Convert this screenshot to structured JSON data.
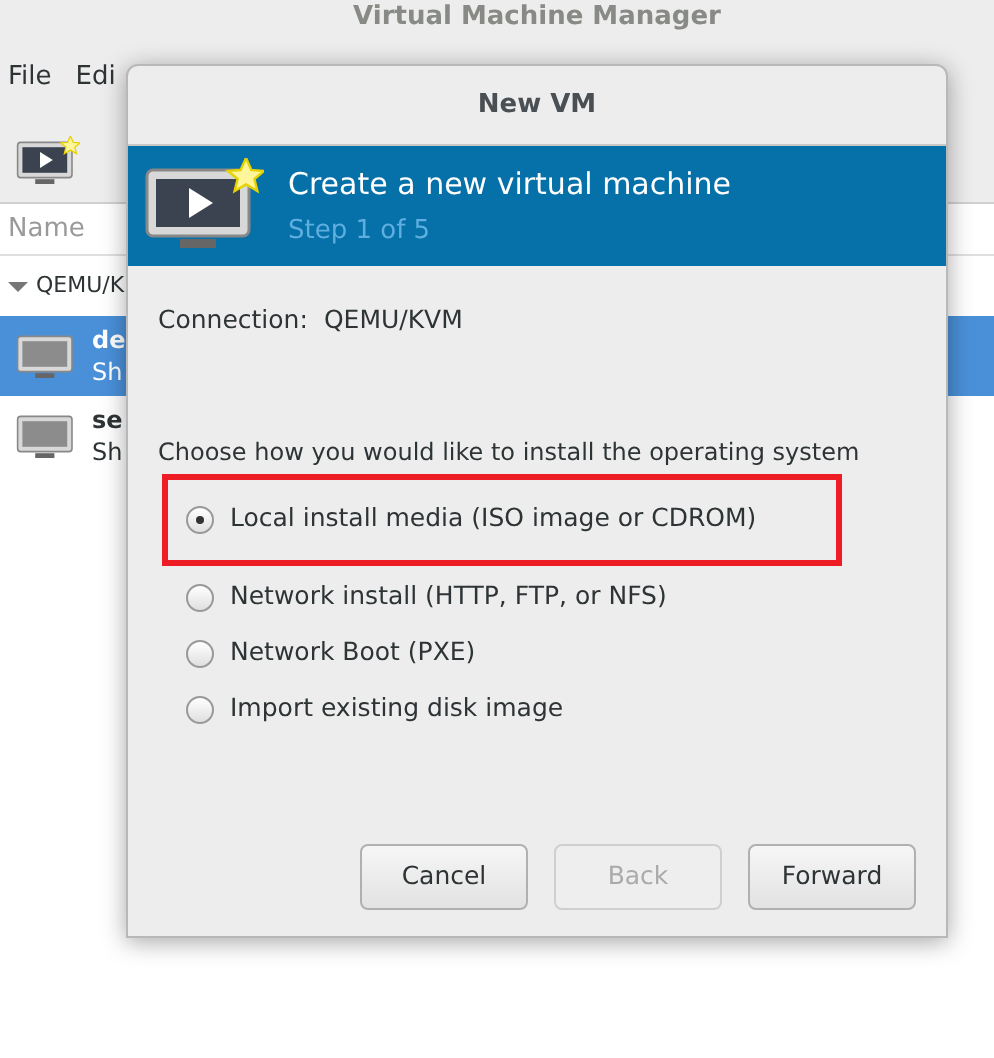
{
  "background_window": {
    "title": "Virtual Machine Manager",
    "menu": [
      "File",
      "Edi"
    ],
    "column_header": "Name",
    "tree": {
      "label": "QEMU/K",
      "expanded": true,
      "children": [
        {
          "name": "de",
          "status": "Sh",
          "selected": true
        },
        {
          "name": "se",
          "status": "Sh",
          "selected": false
        }
      ]
    }
  },
  "dialog": {
    "title": "New VM",
    "header": {
      "title": "Create a new virtual machine",
      "step": "Step 1 of 5"
    },
    "connection_label": "Connection:",
    "connection_value": "QEMU/KVM",
    "prompt": "Choose how you would like to install the operating system",
    "options": [
      {
        "label": "Local install media (ISO image or CDROM)",
        "selected": true
      },
      {
        "label": "Network install (HTTP, FTP, or NFS)",
        "selected": false
      },
      {
        "label": "Network Boot (PXE)",
        "selected": false
      },
      {
        "label": "Import existing disk image",
        "selected": false
      }
    ],
    "buttons": [
      {
        "label": "Cancel",
        "disabled": false
      },
      {
        "label": "Back",
        "disabled": true
      },
      {
        "label": "Forward",
        "disabled": false
      }
    ]
  }
}
